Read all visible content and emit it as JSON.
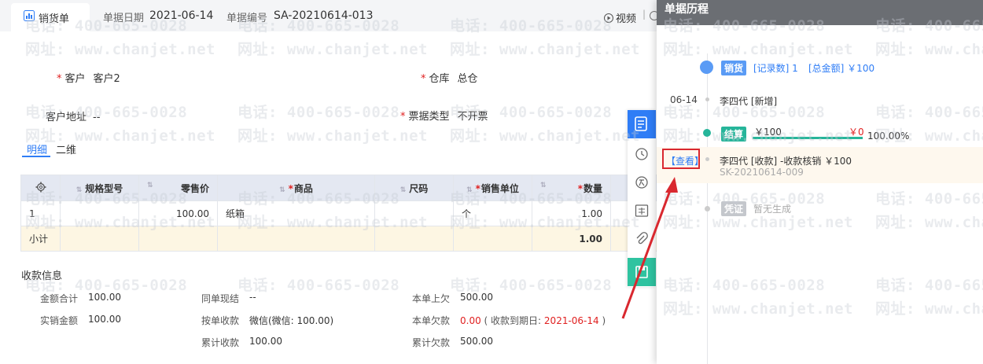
{
  "header": {
    "tab_label": "销货单",
    "date_label": "单据日期",
    "date_value": "2021-06-14",
    "code_label": "单据编号",
    "code_value": "SA-20210614-013",
    "video_label": "视频"
  },
  "form": {
    "customer_label": "客户",
    "customer_value": "客户2",
    "warehouse_label": "仓库",
    "warehouse_value": "总仓",
    "address_label": "客户地址",
    "address_value": "--",
    "invoice_type_label": "票据类型",
    "invoice_type_value": "不开票"
  },
  "subtabs": [
    "明细",
    "二维"
  ],
  "table": {
    "headers": [
      "规格型号",
      "零售价",
      "商品",
      "尺码",
      "销售单位",
      "数量"
    ],
    "row": {
      "index": "1",
      "spec": "",
      "retail_price": "100.00",
      "product": "纸箱",
      "size": "",
      "unit": "个",
      "qty": "1.00"
    },
    "subtotal_label": "小计",
    "subtotal_qty": "1.00"
  },
  "payment": {
    "section_title": "收款信息",
    "total_label": "金额合计",
    "total_value": "100.00",
    "net_label": "实销金额",
    "net_value": "100.00",
    "same_settle_label": "同单现结",
    "same_settle_value": "--",
    "by_order_label": "按单收款",
    "by_order_value": "微信(微信: 100.00)",
    "cum_recv_label": "累计收款",
    "cum_recv_value": "100.00",
    "prev_owe_label": "本单上欠",
    "prev_owe_value": "500.00",
    "cur_owe_label": "本单欠款",
    "cur_owe_value": "0.00",
    "due_prefix": "( 收款到期日:",
    "due_date": "2021-06-14",
    "due_suffix": ")",
    "cum_owe_label": "累计欠款",
    "cum_owe_value": "500.00"
  },
  "history": {
    "title": "单据历程",
    "sale_tag": "销货",
    "record_count": "[记录数] 1",
    "total_amount": "[总金额] ￥100",
    "date": "06-14",
    "event1": "李四代 [新增]",
    "settle_tag": "结算",
    "settle_amount": "￥100",
    "settle_remain": "￥0",
    "settle_percent": "100.00%",
    "settle_ratio": 1.0,
    "view_link": "【查看】",
    "event2": "李四代 [收款] -收款核销 ￥100",
    "event2_code": "SK-20210614-009",
    "voucher_tag": "凭证",
    "voucher_text": "暂无生成"
  },
  "watermark": {
    "phone": "电话: 400-665-0028",
    "site": "网址: www.chanjet.net"
  },
  "colors": {
    "accent": "#2f7df6",
    "settle_green": "#26b59a",
    "required_red": "#e02020",
    "highlight_red": "#d9282f"
  },
  "icons": [
    "chart-icon",
    "play-icon",
    "gear-icon",
    "form-icon",
    "history-icon",
    "owe-icon",
    "coupon-icon",
    "attachment-icon",
    "save-icon"
  ]
}
